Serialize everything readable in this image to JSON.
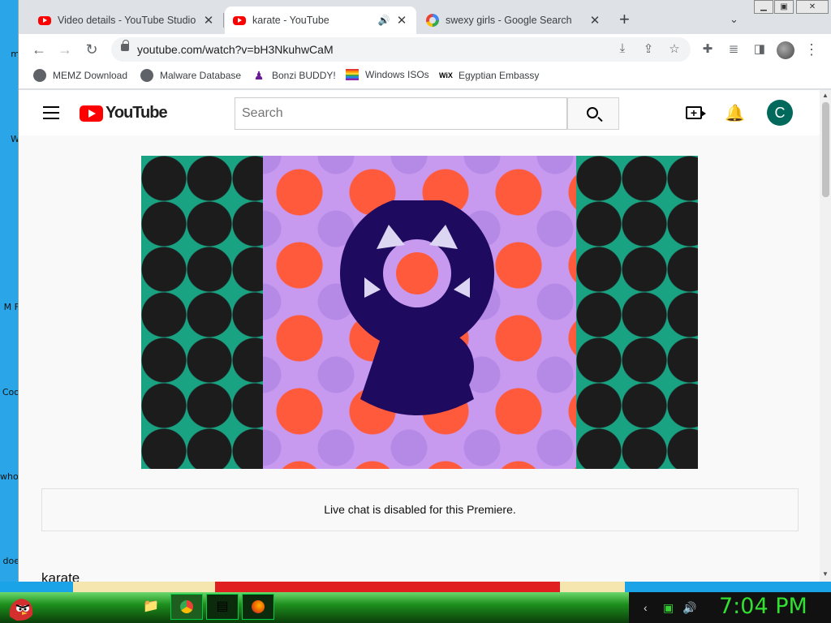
{
  "desktop": {
    "icons": [
      "m",
      "W",
      "",
      "M F",
      "Coo",
      "who us",
      "doe"
    ]
  },
  "browser": {
    "tabs": [
      {
        "title": "Video details - YouTube Studio",
        "favicon": "youtube-icon",
        "active": false
      },
      {
        "title": "karate - YouTube",
        "favicon": "youtube-icon",
        "active": true,
        "audio": true
      },
      {
        "title": "swexy girls - Google Search",
        "favicon": "google-icon",
        "active": false
      }
    ],
    "url": "youtube.com/watch?v=bH3NkuhwCaM",
    "bookmarks": [
      {
        "label": "MEMZ Download",
        "icon": "globe-icon"
      },
      {
        "label": "Malware Database",
        "icon": "globe-icon"
      },
      {
        "label": "Bonzi BUDDY!",
        "icon": "bonzi-icon"
      },
      {
        "label": "Windows ISOs",
        "icon": "rainbow-flag-icon"
      },
      {
        "label": "Egyptian Embassy",
        "icon": "wix-icon"
      }
    ]
  },
  "youtube": {
    "logo_text": "YouTube",
    "search_placeholder": "Search",
    "avatar_letter": "C",
    "chat_message": "Live chat is disabled for this Premiere.",
    "video_title": "karate"
  },
  "taskbar": {
    "clock": "7:04 PM"
  },
  "colors": {
    "youtube_red": "#ff0000",
    "avatar_bg": "#00695c",
    "clock_green": "#31e031"
  }
}
